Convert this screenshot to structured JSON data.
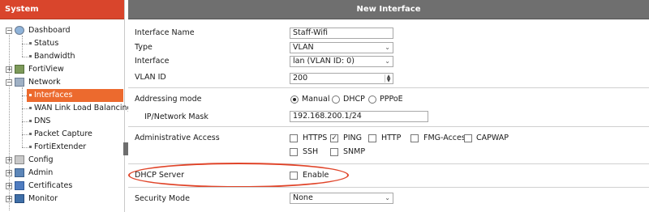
{
  "sidebar": {
    "title": "System",
    "items": [
      {
        "label": "Dashboard",
        "expander": "-",
        "icon": "dashboard-icon"
      },
      {
        "label": "Status"
      },
      {
        "label": "Bandwidth"
      },
      {
        "label": "FortiView",
        "expander": "+",
        "icon": "fortiview-icon"
      },
      {
        "label": "Network",
        "expander": "-",
        "icon": "network-icon"
      },
      {
        "label": "Interfaces",
        "active": true
      },
      {
        "label": "WAN Link Load Balancing"
      },
      {
        "label": "DNS"
      },
      {
        "label": "Packet Capture"
      },
      {
        "label": "FortiExtender"
      },
      {
        "label": "Config",
        "expander": "+",
        "icon": "config-icon"
      },
      {
        "label": "Admin",
        "expander": "+",
        "icon": "admin-icon"
      },
      {
        "label": "Certificates",
        "expander": "+",
        "icon": "certificates-icon"
      },
      {
        "label": "Monitor",
        "expander": "+",
        "icon": "monitor-icon"
      }
    ]
  },
  "main": {
    "title": "New Interface",
    "interface_name": {
      "label": "Interface Name",
      "value": "Staff-Wifi"
    },
    "type": {
      "label": "Type",
      "value": "VLAN"
    },
    "interface": {
      "label": "Interface",
      "value": "lan (VLAN ID: 0)"
    },
    "vlan_id": {
      "label": "VLAN ID",
      "value": "200"
    },
    "addressing": {
      "label": "Addressing mode",
      "options": [
        "Manual",
        "DHCP",
        "PPPoE"
      ],
      "selected": "Manual"
    },
    "ip_mask": {
      "label": "IP/Network Mask",
      "value": "192.168.200.1/24"
    },
    "admin_access": {
      "label": "Administrative Access",
      "options": [
        "HTTPS",
        "PING",
        "HTTP",
        "FMG-Access",
        "CAPWAP",
        "SSH",
        "SNMP"
      ],
      "checked": [
        "PING"
      ]
    },
    "dhcp_server": {
      "label": "DHCP Server",
      "option": "Enable",
      "checked": false
    },
    "security_mode": {
      "label": "Security Mode",
      "value": "None"
    }
  },
  "colors": {
    "sidebar_header": "#d9452c",
    "active_item": "#ec6a2e",
    "main_header": "#6f6f6f",
    "highlight": "#e0452a"
  }
}
